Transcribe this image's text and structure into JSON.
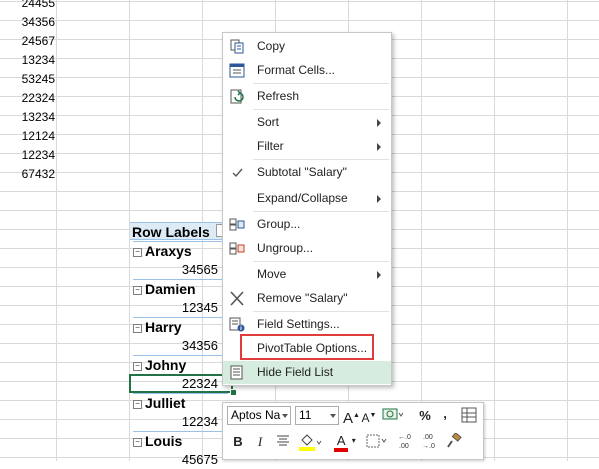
{
  "sheet": {
    "column_values": [
      "24455",
      "34356",
      "24567",
      "13234",
      "53245",
      "22324",
      "13234",
      "12124",
      "12234",
      "67432"
    ]
  },
  "pivot": {
    "header": "Row Labels",
    "rows": [
      {
        "name": "Araxys",
        "value": "34565"
      },
      {
        "name": "Damien",
        "value": "12345"
      },
      {
        "name": "Harry",
        "value": "34356"
      },
      {
        "name": "Johny",
        "value": "22324"
      },
      {
        "name": "Julliet",
        "value": "12234"
      },
      {
        "name": "Louis",
        "value": "45675"
      }
    ]
  },
  "context_menu": {
    "items": [
      {
        "label": "Copy",
        "icon": "copy-icon"
      },
      {
        "label": "Format Cells...",
        "icon": "format-cells-icon"
      },
      {
        "label": "Refresh",
        "icon": "refresh-icon"
      },
      {
        "label": "Sort",
        "icon": "",
        "submenu": true
      },
      {
        "label": "Filter",
        "icon": "",
        "submenu": true
      },
      {
        "label": "Subtotal \"Salary\"",
        "icon": "checkmark-icon"
      },
      {
        "label": "Expand/Collapse",
        "icon": "",
        "submenu": true
      },
      {
        "label": "Group...",
        "icon": "group-icon"
      },
      {
        "label": "Ungroup...",
        "icon": "ungroup-icon"
      },
      {
        "label": "Move",
        "icon": "",
        "submenu": true
      },
      {
        "label": "Remove \"Salary\"",
        "icon": "remove-x-icon"
      },
      {
        "label": "Field Settings...",
        "icon": "field-settings-icon"
      },
      {
        "label": "PivotTable Options...",
        "icon": ""
      },
      {
        "label": "Hide Field List",
        "icon": "field-list-icon"
      }
    ]
  },
  "mini_toolbar": {
    "font_name": "Aptos Na",
    "font_size": "11",
    "grow_font": "A",
    "shrink_font": "A",
    "currency": "$",
    "percent": "%",
    "comma": ",",
    "bold": "B",
    "italic": "I",
    "font_color_letter": "A",
    "increase_decimal": "←.0\n.00",
    "decrease_decimal": ".00\n→.0"
  },
  "colors": {
    "accent_green": "#217346",
    "hover_green": "#d5ecdf",
    "highlight_red": "#e03c3c",
    "pivot_header_bg": "#ddebf7"
  }
}
